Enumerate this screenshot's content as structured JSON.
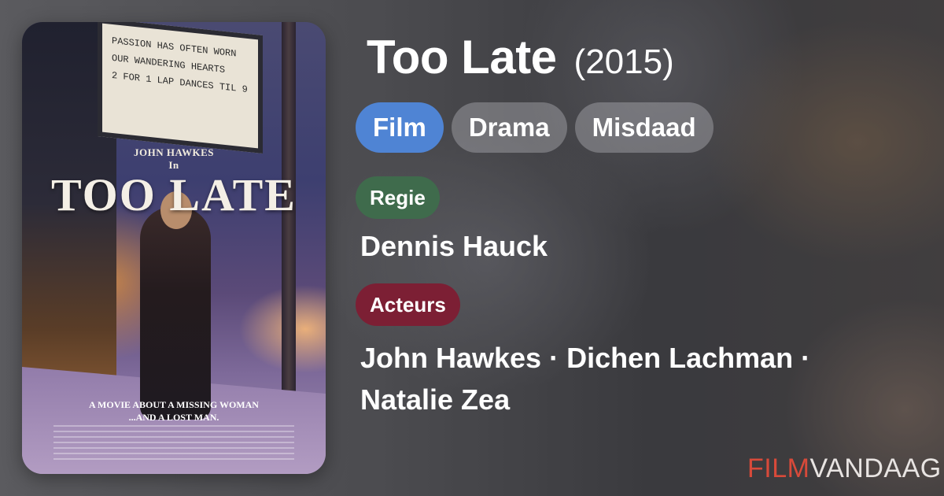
{
  "poster": {
    "marquee": [
      "PASSION HAS OFTEN WORN",
      "OUR WANDERING HEARTS",
      "2 FOR 1 LAP DANCES TIL 9"
    ],
    "actor_line": "JOHN HAWKES",
    "actor_in": "In",
    "title": "TOO LATE",
    "tagline_1": "A MOVIE ABOUT A MISSING WOMAN",
    "tagline_2": "...AND A LOST MAN."
  },
  "movie": {
    "title": "Too Late",
    "year": "(2015)"
  },
  "genres": [
    {
      "label": "Film"
    },
    {
      "label": "Drama"
    },
    {
      "label": "Misdaad"
    }
  ],
  "director": {
    "label": "Regie",
    "name": "Dennis Hauck"
  },
  "cast": {
    "label": "Acteurs",
    "names": "John Hawkes · Dichen Lachman · Natalie Zea"
  },
  "brand": {
    "part1": "FILM",
    "part2": "VANDAAG"
  },
  "colors": {
    "film_chip": "#4f84d4",
    "regie_chip": "#3f6b4c",
    "acteurs_chip": "#7c1f34",
    "brand_red": "#d84a3a"
  }
}
